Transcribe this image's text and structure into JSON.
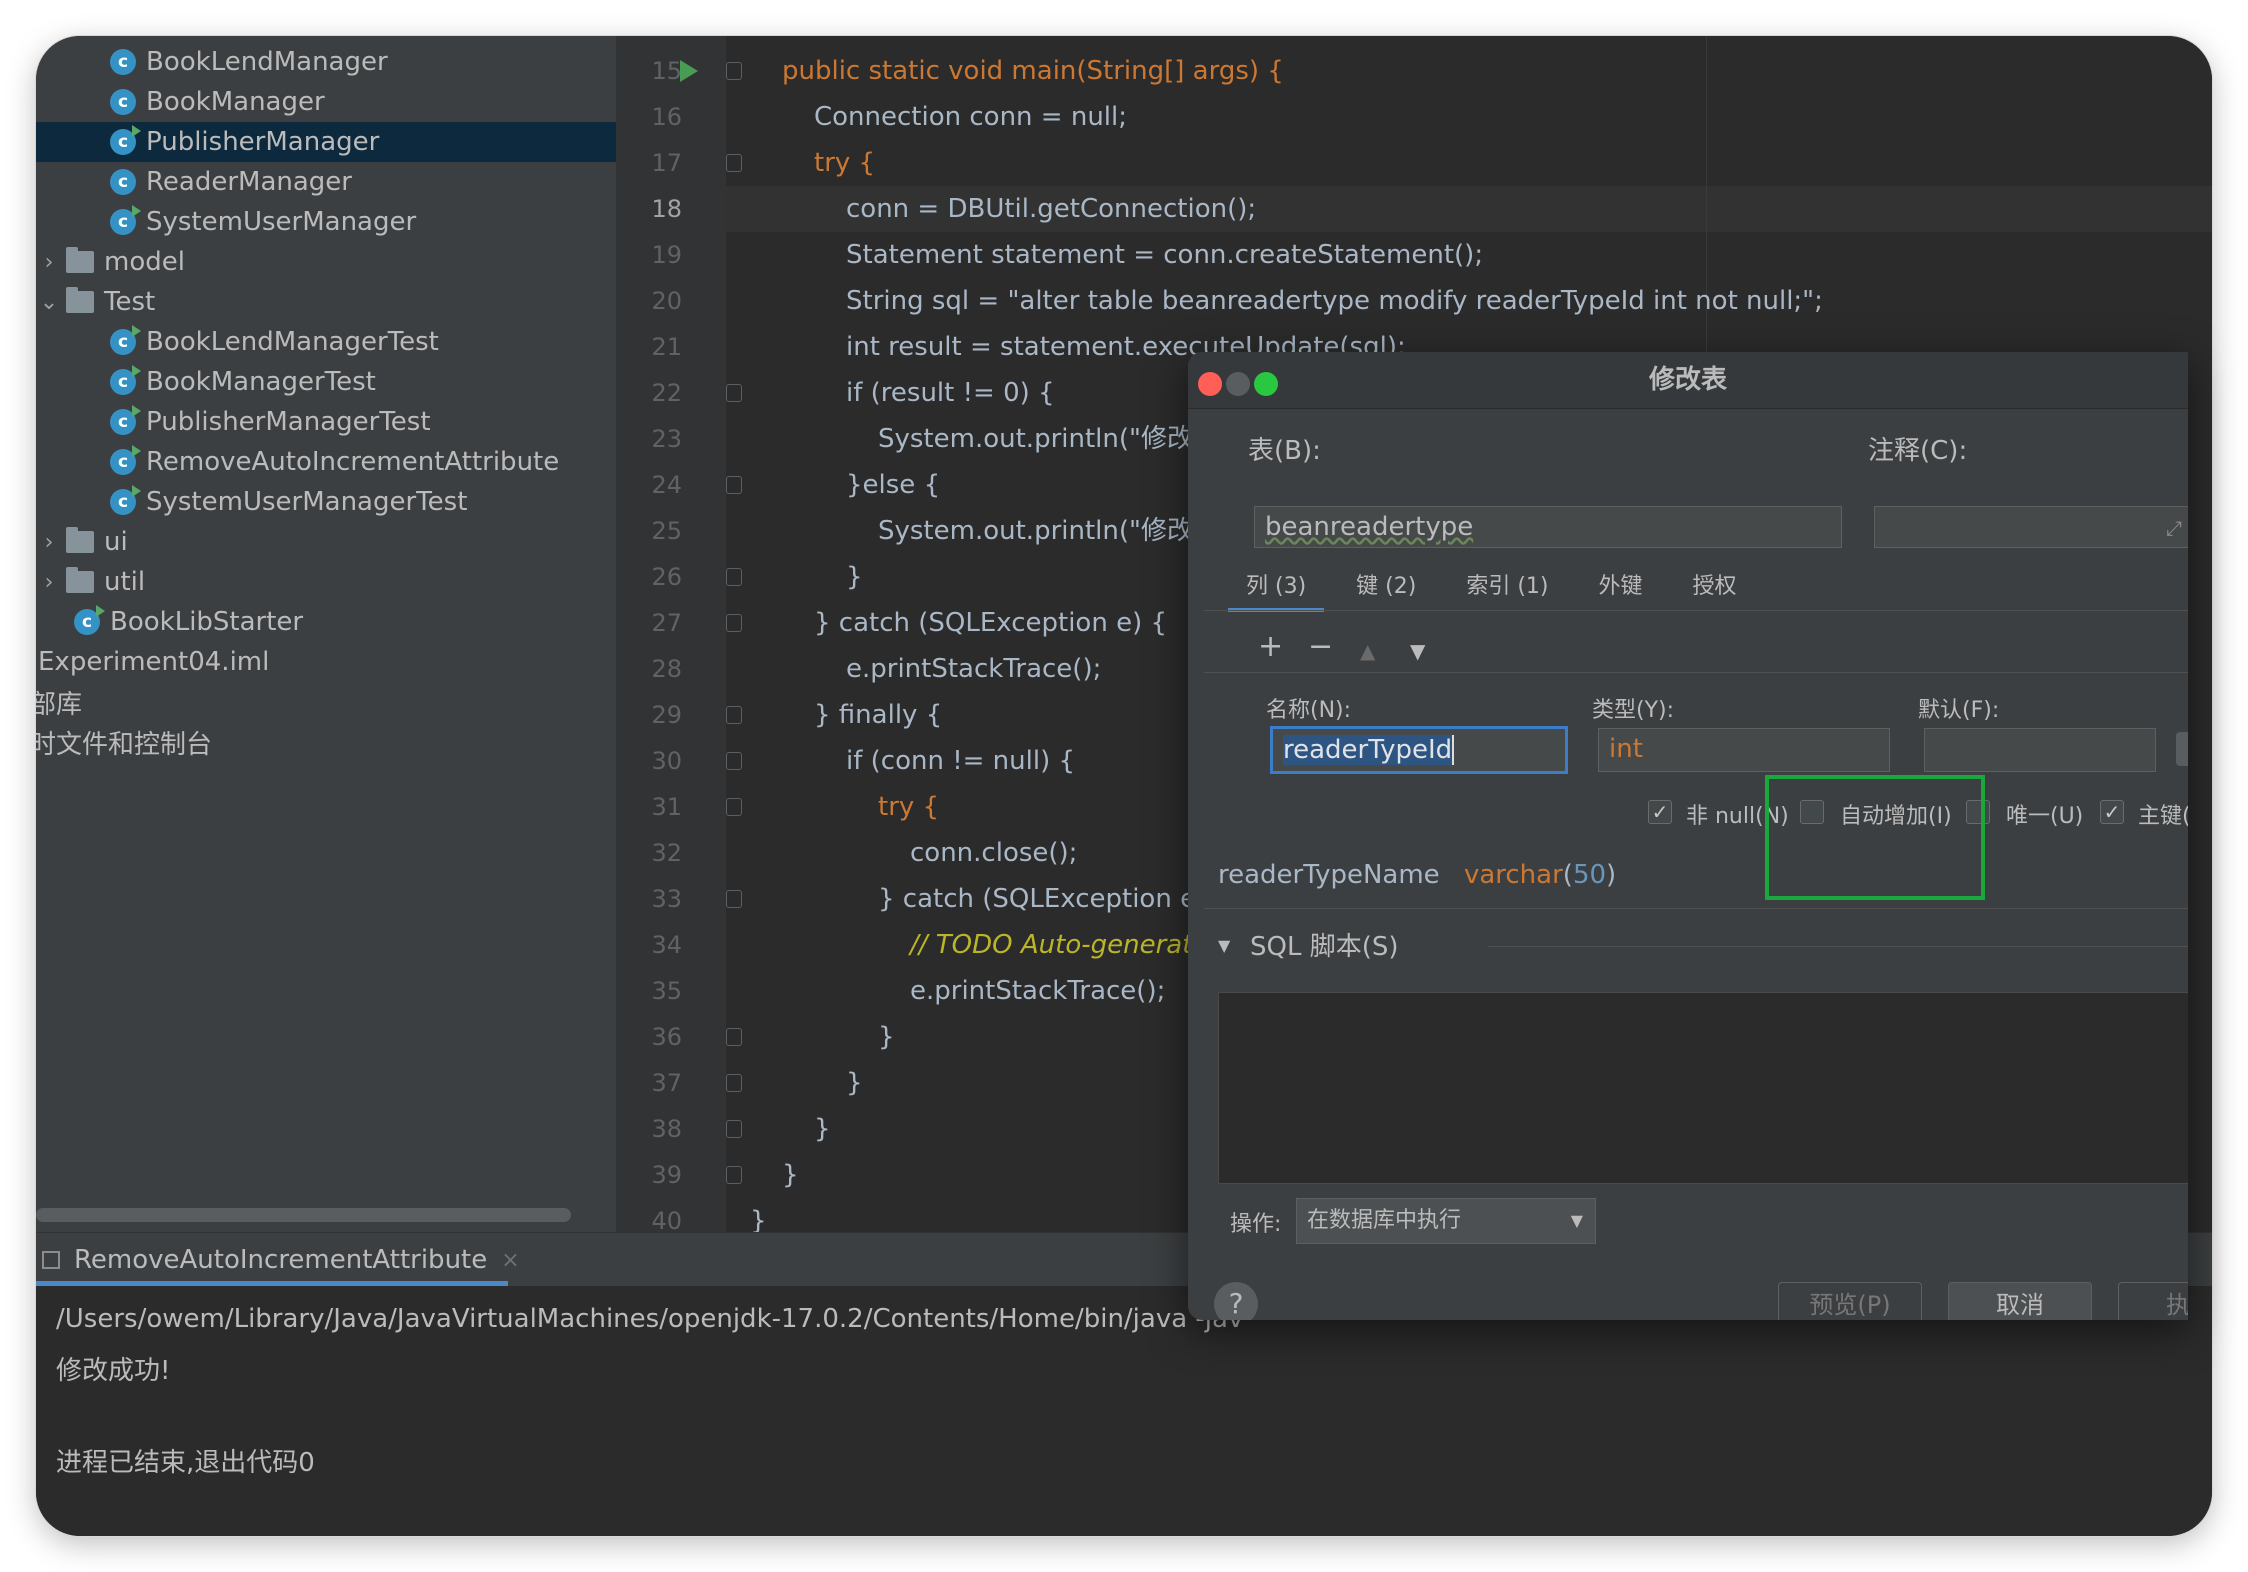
{
  "project_tree": {
    "items": [
      {
        "label": "BookLendManager",
        "icon": "java-class-icon"
      },
      {
        "label": "BookManager",
        "icon": "java-class-icon"
      },
      {
        "label": "PublisherManager",
        "icon": "java-class-run-icon",
        "selected": true
      },
      {
        "label": "ReaderManager",
        "icon": "java-class-icon"
      },
      {
        "label": "SystemUserManager",
        "icon": "java-class-run-icon"
      },
      {
        "label": "model",
        "icon": "folder-icon",
        "expanded": false
      },
      {
        "label": "Test",
        "icon": "folder-icon",
        "expanded": true
      },
      {
        "label": "BookLendManagerTest",
        "icon": "java-class-run-icon"
      },
      {
        "label": "BookManagerTest",
        "icon": "java-class-run-icon"
      },
      {
        "label": "PublisherManagerTest",
        "icon": "java-class-run-icon"
      },
      {
        "label": "RemoveAutoIncrementAttribute",
        "icon": "java-class-run-icon"
      },
      {
        "label": "SystemUserManagerTest",
        "icon": "java-class-run-icon"
      },
      {
        "label": "ui",
        "icon": "folder-icon",
        "expanded": false
      },
      {
        "label": "util",
        "icon": "folder-icon",
        "expanded": false
      },
      {
        "label": "BookLibStarter",
        "icon": "java-class-run-icon"
      },
      {
        "label": "Experiment04.iml",
        "icon": "iml-file"
      },
      {
        "label": "部库",
        "icon": ""
      },
      {
        "label": "时文件和控制台",
        "icon": ""
      }
    ]
  },
  "editor": {
    "current_line": "18",
    "lines": [
      {
        "n": "15",
        "text": "public static void main(String[] args) {"
      },
      {
        "n": "16",
        "text": "Connection conn = null;"
      },
      {
        "n": "17",
        "text": "try {"
      },
      {
        "n": "18",
        "text": "conn = DBUtil.getConnection();"
      },
      {
        "n": "19",
        "text": "Statement statement = conn.createStatement();"
      },
      {
        "n": "20",
        "text": "String sql = \"alter table beanreadertype modify readerTypeId int not null;\";"
      },
      {
        "n": "21",
        "text": "int result = statement.executeUpdate(sql);"
      },
      {
        "n": "22",
        "text": "if (result != 0) {"
      },
      {
        "n": "23",
        "text": "System.out.println(\"修改成功"
      },
      {
        "n": "24",
        "text": "}else {"
      },
      {
        "n": "25",
        "text": "System.out.println(\"修改失败"
      },
      {
        "n": "26",
        "text": "}"
      },
      {
        "n": "27",
        "text": "} catch (SQLException e) {"
      },
      {
        "n": "28",
        "text": "e.printStackTrace();"
      },
      {
        "n": "29",
        "text": "} finally {"
      },
      {
        "n": "30",
        "text": "if (conn != null) {"
      },
      {
        "n": "31",
        "text": "try {"
      },
      {
        "n": "32",
        "text": "conn.close();"
      },
      {
        "n": "33",
        "text": "} catch (SQLException e) {"
      },
      {
        "n": "34",
        "text": "// TODO Auto-generated"
      },
      {
        "n": "35",
        "text": "e.printStackTrace();"
      },
      {
        "n": "36",
        "text": "}"
      },
      {
        "n": "37",
        "text": "}"
      },
      {
        "n": "38",
        "text": "}"
      },
      {
        "n": "39",
        "text": "}"
      },
      {
        "n": "40",
        "text": "}"
      }
    ]
  },
  "run_panel": {
    "tab_label": "RemoveAutoIncrementAttribute",
    "close_glyph": "×",
    "lines": [
      "/Users/owem/Library/Java/JavaVirtualMachines/openjdk-17.0.2/Contents/Home/bin/java -jav",
      "修改成功!",
      "",
      "进程已结束,退出代码0"
    ]
  },
  "dialog": {
    "title": "修改表",
    "table_label": "表(B):",
    "table_value": "beanreadertype",
    "comment_label": "注释(C):",
    "comment_value": "",
    "tabs": [
      "列 (3)",
      "键 (2)",
      "索引 (1)",
      "外键",
      "授权"
    ],
    "active_tab": 0,
    "toolbar": {
      "add": "+",
      "remove": "−",
      "up": "▲",
      "down": "▼"
    },
    "name_label": "名称(N):",
    "type_label": "类型(Y):",
    "default_label": "默认(F):",
    "name_value": "readerTypeId",
    "type_value": "int",
    "default_value": "",
    "checkboxes": [
      {
        "label": "非 null(N)",
        "checked": true
      },
      {
        "label": "自动增加(I)",
        "checked": false
      },
      {
        "label": "唯一(U)",
        "checked": false
      },
      {
        "label": "主键(P)",
        "checked": true
      }
    ],
    "check_glyph": "✓",
    "other_column": {
      "name": "readerTypeName",
      "type": "varchar",
      "length": "50"
    },
    "sql_section_label": "SQL 脚本(S)",
    "operation_label": "操作:",
    "operation_value": "在数据库中执行",
    "buttons": {
      "help": "?",
      "preview": "预览(P)",
      "cancel": "取消",
      "execute": "执行"
    }
  },
  "colors": {
    "ide_bg": "#2b2b2b",
    "panel_bg": "#3c3f41",
    "keyword": "#cc7832",
    "string": "#6a8759",
    "number": "#6897bb",
    "function": "#ffc66d",
    "accent": "#4a88c7",
    "highlight_box": "#1aa83c"
  }
}
